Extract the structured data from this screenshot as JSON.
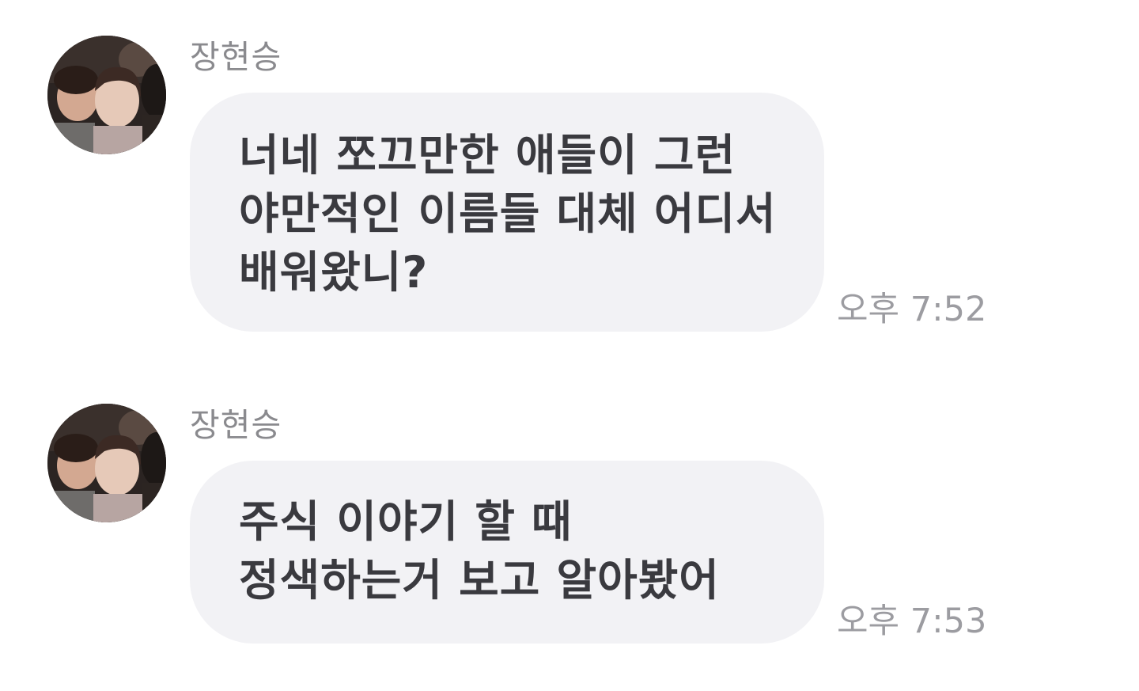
{
  "messages": [
    {
      "sender": "장현승",
      "lines": [
        "너네 쪼끄만한 애들이 그런",
        "야만적인 이름들 대체 어디서",
        "배워왔니?"
      ],
      "time": "오후 7:52"
    },
    {
      "sender": "장현승",
      "lines": [
        "주식 이야기 할 때",
        "정색하는거 보고 알아봤어"
      ],
      "time": "오후 7:53"
    }
  ],
  "colors": {
    "bubble": "#f2f2f5",
    "message_text": "#3a3a3f",
    "sender_text": "#8a8a8e",
    "time_text": "#9c9ca1"
  }
}
